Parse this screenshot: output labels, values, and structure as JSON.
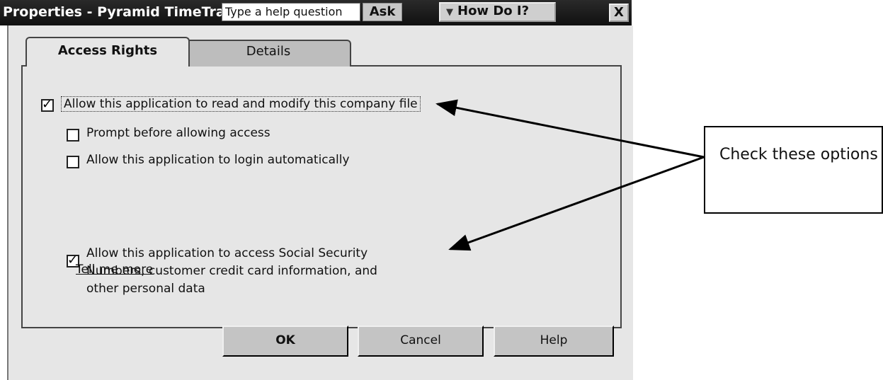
{
  "window": {
    "title": "Properties - Pyramid TimeTracker",
    "help_input_value": "Type a help question",
    "ask_label": "Ask",
    "how_do_i_label": "How Do I?",
    "close_label": "X"
  },
  "tabs": [
    {
      "label": "Access Rights",
      "active": true
    },
    {
      "label": "Details",
      "active": false
    }
  ],
  "options": {
    "read_modify": {
      "label": "Allow this application to read and modify this company file",
      "checked": true
    },
    "prompt_before": {
      "label": "Prompt before allowing access",
      "checked": false
    },
    "login_auto": {
      "label": "Allow this application to login automatically",
      "checked": false
    },
    "ssn_access": {
      "label": "Allow this application to access Social Security Numbers, customer credit card information, and other personal data",
      "checked": true
    }
  },
  "links": {
    "tell_me_more": "Tell me more"
  },
  "buttons": {
    "ok": "OK",
    "cancel": "Cancel",
    "help": "Help"
  },
  "callout": {
    "text": "Check these options"
  }
}
